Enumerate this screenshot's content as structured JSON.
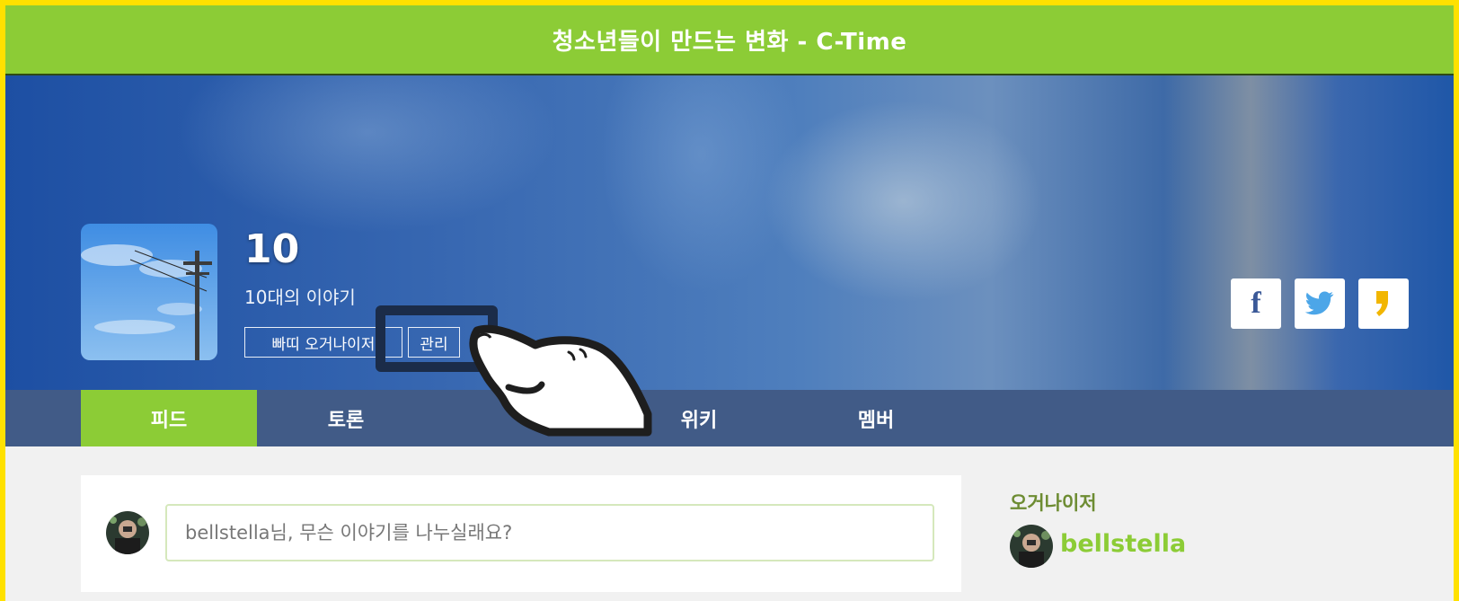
{
  "header": {
    "title": "청소년들이 만드는 변화 - C-Time"
  },
  "community": {
    "name": "10",
    "description": "10대의 이야기",
    "organizer_button": "빠띠 오거나이저",
    "manage_button": "관리"
  },
  "share": {
    "facebook_icon": "f",
    "twitter_icon": "twitter-bird-icon",
    "kakaostory_icon": "kakaostory-icon"
  },
  "tabs": [
    {
      "label": "피드",
      "active": true
    },
    {
      "label": "토론",
      "active": false
    },
    {
      "label": "",
      "active": false
    },
    {
      "label": "위키",
      "active": false
    },
    {
      "label": "멤버",
      "active": false
    }
  ],
  "post": {
    "placeholder": "bellstella님, 무슨 이야기를 나누실래요?"
  },
  "sidebar": {
    "organizer_heading": "오거나이저",
    "organizer_name": "bellstella"
  },
  "colors": {
    "accent_green": "#8ccc36",
    "frame_yellow": "#ffe100",
    "overlay_navy": "#1b2c49"
  }
}
